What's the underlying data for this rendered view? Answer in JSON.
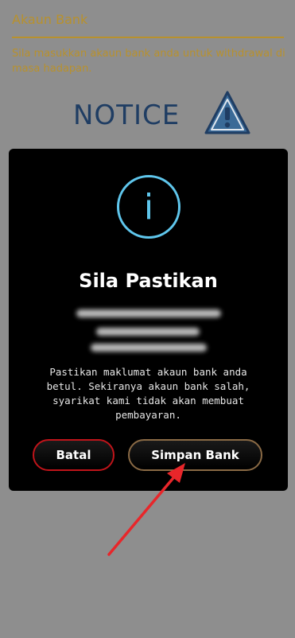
{
  "section": {
    "title": "Akaun Bank",
    "description": "Sila masukkan akaun bank anda untuk withdrawal di masa hadapan."
  },
  "notice": {
    "label": "NOTICE"
  },
  "modal": {
    "icon_glyph": "i",
    "title": "Sila Pastikan",
    "body": "Pastikan maklumat akaun bank anda betul. Sekiranya akaun bank salah, syarikat kami tidak akan membuat pembayaran.",
    "cancel_label": "Batal",
    "confirm_label": "Simpan Bank"
  },
  "colors": {
    "gold": "#b8912d",
    "info_blue": "#5fc6ec",
    "cancel_border": "#c0141a",
    "annotation_arrow": "#e8262a"
  }
}
